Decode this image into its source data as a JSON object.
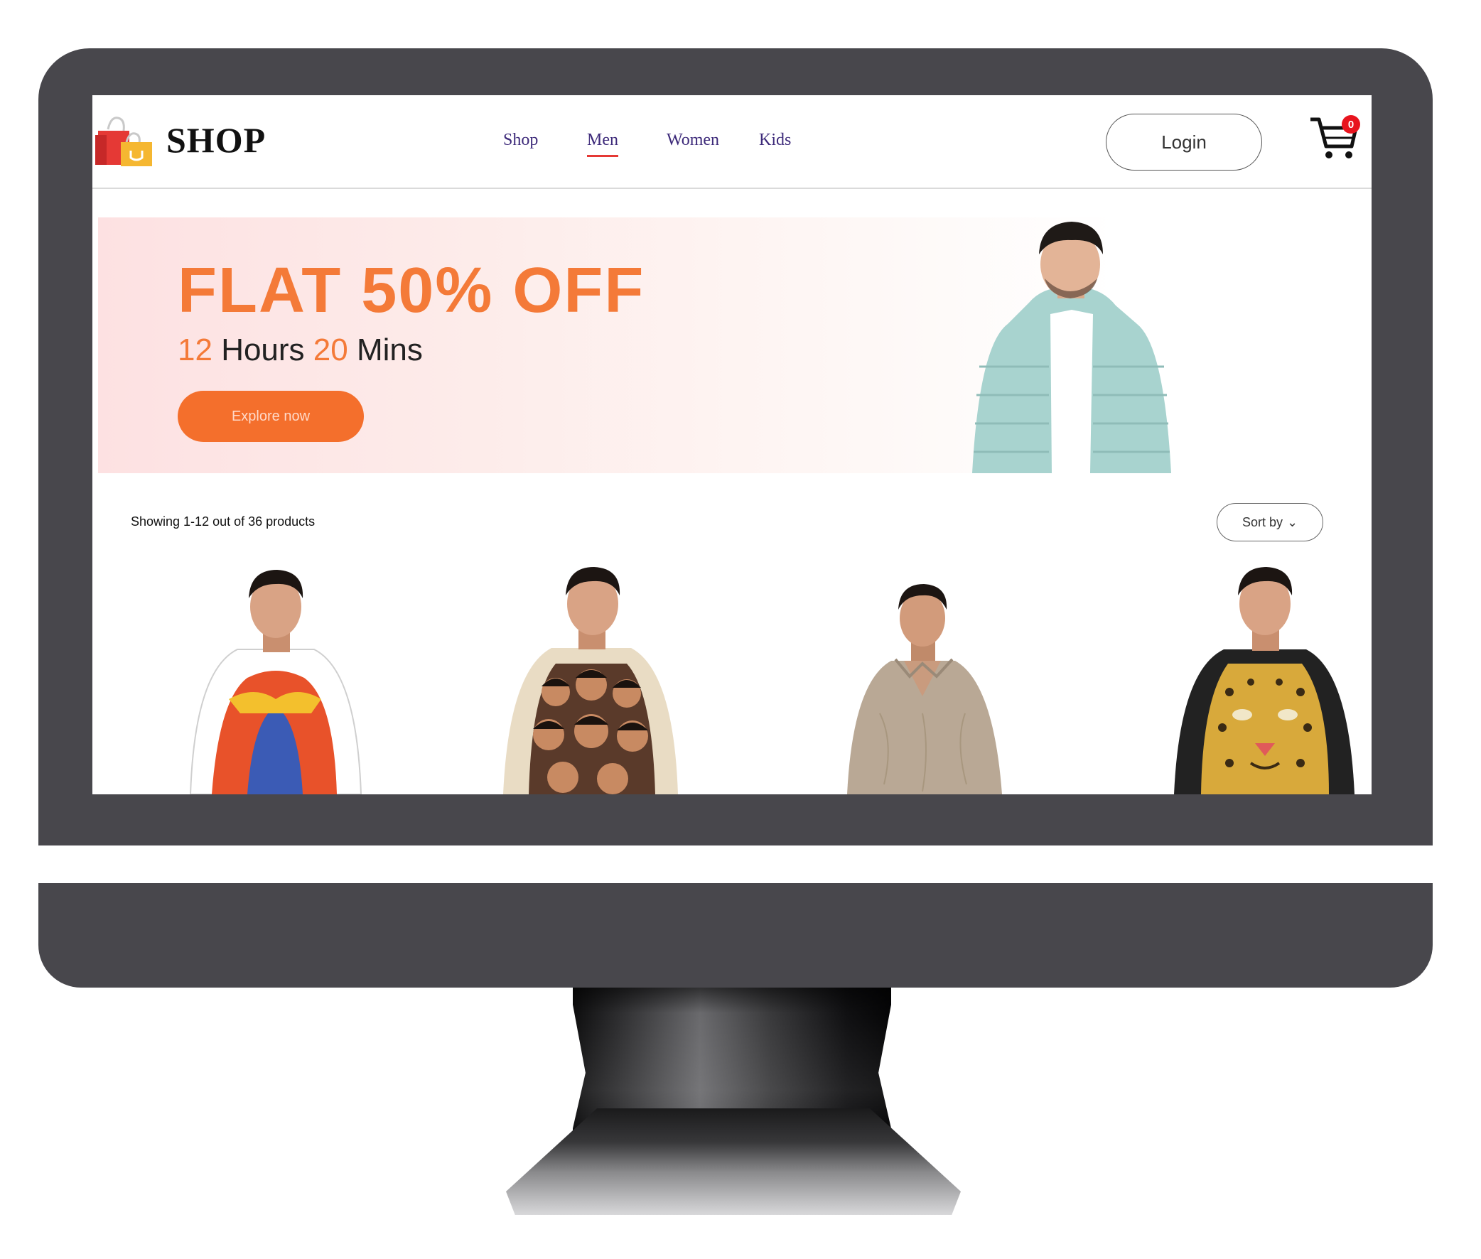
{
  "header": {
    "logo_text": "SHOP",
    "nav": [
      {
        "label": "Shop",
        "active": false
      },
      {
        "label": "Men",
        "active": true
      },
      {
        "label": "Women",
        "active": false
      },
      {
        "label": "Kids",
        "active": false
      }
    ],
    "login_label": "Login",
    "cart_count": "0"
  },
  "banner": {
    "headline": "FLAT 50% OFF",
    "countdown": {
      "hours": "12",
      "hours_label": "Hours",
      "mins": "20",
      "mins_label": "Mins"
    },
    "cta_label": "Explore now"
  },
  "products": {
    "showing_text": "Showing 1-12 out of 36 products",
    "sort_label": "Sort by",
    "items": [
      {
        "icon": "graphic-print-tshirt",
        "shirt_color": "#ffffff",
        "print_color": "#e8522a"
      },
      {
        "icon": "faces-print-tshirt",
        "shirt_color": "#e9dcc4",
        "print_color": "#5a3a2a"
      },
      {
        "icon": "collar-tshirt",
        "shirt_color": "#b9a895",
        "print_color": "#b9a895"
      },
      {
        "icon": "leopard-print-tshirt",
        "shirt_color": "#222222",
        "print_color": "#d8a93b"
      }
    ]
  },
  "colors": {
    "accent": "#f47a38",
    "button": "#f46f2c",
    "nav_text": "#3d2a7a",
    "active_underline": "#e53935",
    "badge": "#e8141e",
    "bezel": "#48474c"
  }
}
